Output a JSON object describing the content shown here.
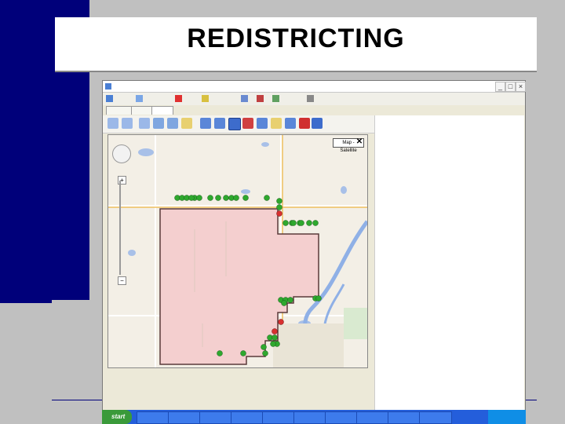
{
  "slide": {
    "title": "REDISTRICTING"
  },
  "colors": {
    "accent": "#00007a",
    "district_fill": "#f4cfcf",
    "district_border": "#5a3a3a",
    "marker_green": "#2ea82e",
    "marker_red": "#d83030"
  },
  "app": {
    "window_title": "",
    "map": {
      "map_type_label": "Map - Satellite",
      "marker_count_green": 36,
      "marker_count_red": 3
    },
    "taskbar": {
      "start_label": "start"
    }
  }
}
